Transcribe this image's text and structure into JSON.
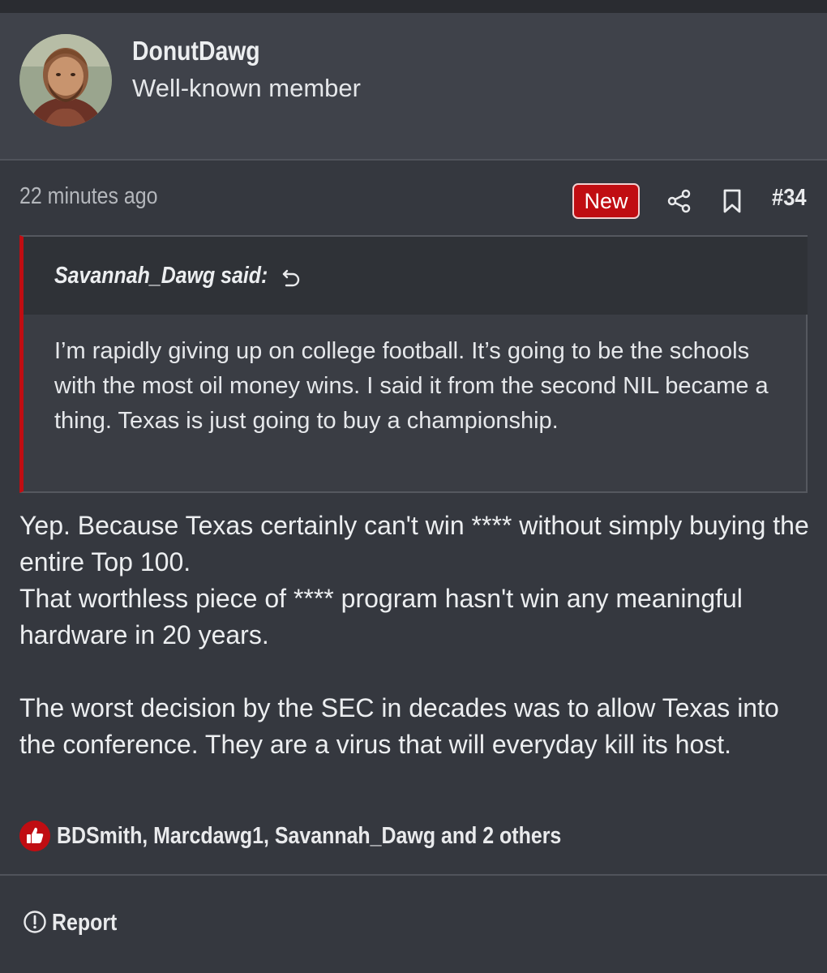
{
  "user": {
    "username": "DonutDawg",
    "title": "Well-known member"
  },
  "post": {
    "time": "22 minutes ago",
    "new_badge": "New",
    "number": "#34",
    "icons": [
      "share-icon",
      "bookmark-icon"
    ]
  },
  "quote": {
    "author": "Savannah_Dawg said:",
    "body": "I’m rapidly giving up on college football. It’s going to be the schools with the most oil money wins. I said it from the second NIL became a thing. Texas is just going to buy a championship."
  },
  "message": {
    "paragraph1_line1": "Yep. Because Texas certainly can't win **** without simply buying the entire Top 100.",
    "paragraph1_line2": "That worthless piece of **** program hasn't win any meaningful hardware in 20 years.",
    "paragraph2": "The worst decision by the SEC in decades was to allow Texas into the conference. They are a virus that will everyday kill its host."
  },
  "reactions": {
    "text": "BDSmith, Marcdawg1, Savannah_Dawg and 2 others"
  },
  "actions": {
    "report_label": "Report"
  },
  "colors": {
    "accent": "#c00d12",
    "background": "#35383f",
    "header_background": "#3f424a"
  }
}
